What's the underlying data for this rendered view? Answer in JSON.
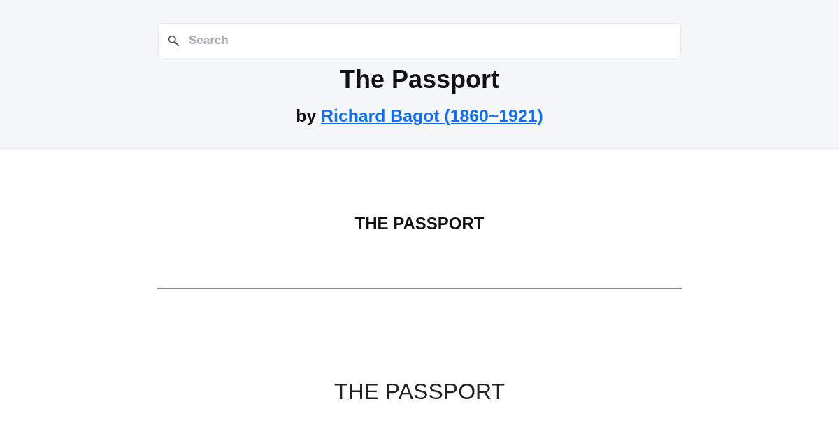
{
  "search": {
    "placeholder": "Search"
  },
  "book": {
    "title": "The Passport",
    "byline_prefix": "by",
    "author": "Richard Bagot (1860~1921)"
  },
  "content": [
    {
      "kind": "heading",
      "text": "THE PASSPORT"
    },
    {
      "kind": "rule"
    },
    {
      "kind": "title",
      "text": "THE PASSPORT"
    }
  ]
}
